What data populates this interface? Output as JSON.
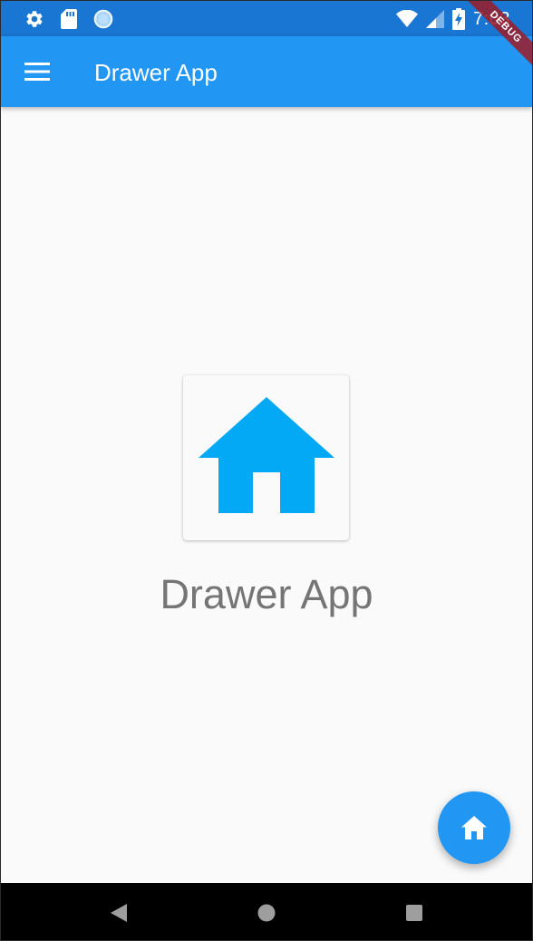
{
  "status_bar": {
    "time": "7:03",
    "icons": [
      "settings-icon",
      "sd-card-icon",
      "sync-circle-icon",
      "wifi-icon",
      "cell-signal-icon",
      "battery-charging-icon"
    ]
  },
  "debug_banner": {
    "label": "DEBUG"
  },
  "app_bar": {
    "title": "Drawer App",
    "menu_icon": "menu-icon"
  },
  "body": {
    "logo_icon": "home-icon",
    "title": "Drawer App"
  },
  "fab": {
    "icon": "home-icon"
  },
  "nav_bar": {
    "buttons": [
      "back-icon",
      "home-circle-icon",
      "recents-icon"
    ]
  },
  "colors": {
    "status_bar": "#1976d2",
    "app_bar": "#2196f3",
    "fab": "#2196f3",
    "logo_house": "#03a9f4",
    "body_title": "#757575",
    "background": "#fafafa",
    "debug_banner": "#9c1c28"
  }
}
